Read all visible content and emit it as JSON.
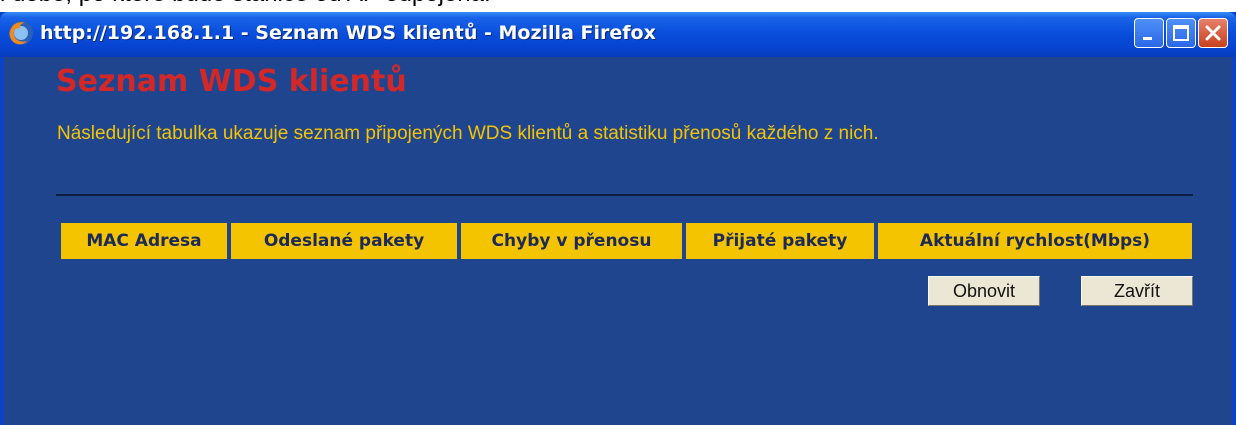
{
  "background": {
    "partial_text": "l době, po které bude stanice od AP odpojena."
  },
  "window": {
    "title": "http://192.168.1.1 - Seznam WDS klientů - Mozilla Firefox",
    "app_icon": "firefox-icon",
    "controls": [
      "minimize-icon",
      "maximize-icon",
      "close-icon"
    ]
  },
  "page": {
    "heading": "Seznam WDS klientů",
    "description": "Následující tabulka ukazuje seznam připojených WDS klientů a statistiku přenosů každého z nich.",
    "table": {
      "columns": [
        "MAC Adresa",
        "Odeslané pakety",
        "Chyby v přenosu",
        "Přijaté pakety",
        "Aktuální rychlost(Mbps)"
      ],
      "rows": []
    },
    "buttons": {
      "refresh": "Obnovit",
      "close": "Zavřít"
    }
  },
  "colors": {
    "heading": "#d42828",
    "description": "#f5c400",
    "table_header_bg": "#f5c400",
    "content_bg": "#1f458e",
    "titlebar": "#0a4fdc"
  }
}
